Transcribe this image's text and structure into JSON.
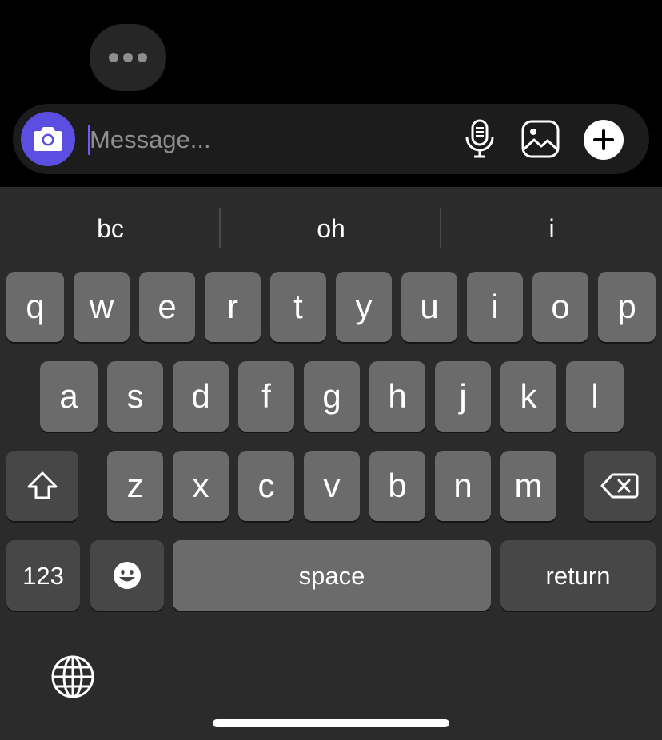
{
  "typing_indicator": {
    "dots": 3
  },
  "composer": {
    "placeholder": "Message...",
    "value": "",
    "icons": [
      "camera-icon",
      "microphone-icon",
      "gallery-icon",
      "plus-icon"
    ],
    "accent_color": "#5b4ee0"
  },
  "keyboard": {
    "suggestions": [
      "bc",
      "oh",
      "i"
    ],
    "row1": [
      "q",
      "w",
      "e",
      "r",
      "t",
      "y",
      "u",
      "i",
      "o",
      "p"
    ],
    "row2": [
      "a",
      "s",
      "d",
      "f",
      "g",
      "h",
      "j",
      "k",
      "l"
    ],
    "row3": [
      "z",
      "x",
      "c",
      "v",
      "b",
      "n",
      "m"
    ],
    "bottom": {
      "numbers": "123",
      "space": "space",
      "return": "return"
    },
    "icons": [
      "shift-icon",
      "backspace-icon",
      "emoji-icon",
      "globe-icon"
    ]
  }
}
